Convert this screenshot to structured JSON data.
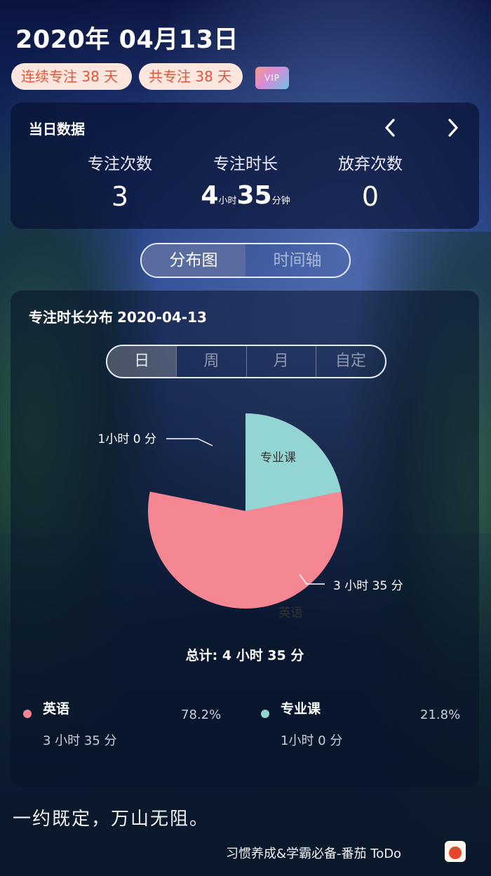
{
  "header": {
    "date": "2020年 04月13日",
    "streak_badge": "连续专注 38 天",
    "total_badge": "共专注 38 天",
    "vip_label": "VIP"
  },
  "daily": {
    "title": "当日数据",
    "prev_icon": "chevron-left-icon",
    "next_icon": "chevron-right-icon",
    "stats": [
      {
        "label": "专注次数",
        "value": "3"
      },
      {
        "label": "专注时长",
        "hours": "4",
        "hours_unit": "小时",
        "minutes": "35",
        "minutes_unit": "分钟"
      },
      {
        "label": "放弃次数",
        "value": "0"
      }
    ]
  },
  "view_tabs": [
    {
      "label": "分布图",
      "active": true
    },
    {
      "label": "时间轴",
      "active": false
    }
  ],
  "distribution": {
    "title": "专注时长分布",
    "date": "2020-04-13",
    "range_tabs": [
      {
        "label": "日",
        "active": true
      },
      {
        "label": "周",
        "active": false
      },
      {
        "label": "月",
        "active": false
      },
      {
        "label": "自定",
        "active": false
      }
    ],
    "total": "总计: 4 小时 35 分",
    "legend": [
      {
        "name": "英语",
        "percent": "78.2%",
        "duration": "3 小时 35 分",
        "color": "#f58793"
      },
      {
        "name": "专业课",
        "percent": "21.8%",
        "duration": "1小时 0 分",
        "color": "#93d5d3"
      }
    ]
  },
  "chart_data": {
    "type": "pie",
    "slices": [
      {
        "label": "英语",
        "value": 215,
        "value_label": "3 小时 35 分",
        "color": "#f58793"
      },
      {
        "label": "专业课",
        "value": 60,
        "value_label": "1小时 0 分",
        "color": "#93d5d3"
      }
    ]
  },
  "motto": "一约既定，万山无阻。",
  "footer": {
    "text": "习惯养成&学霸必备-番茄 ToDo",
    "app_icon": "tomato-icon"
  }
}
